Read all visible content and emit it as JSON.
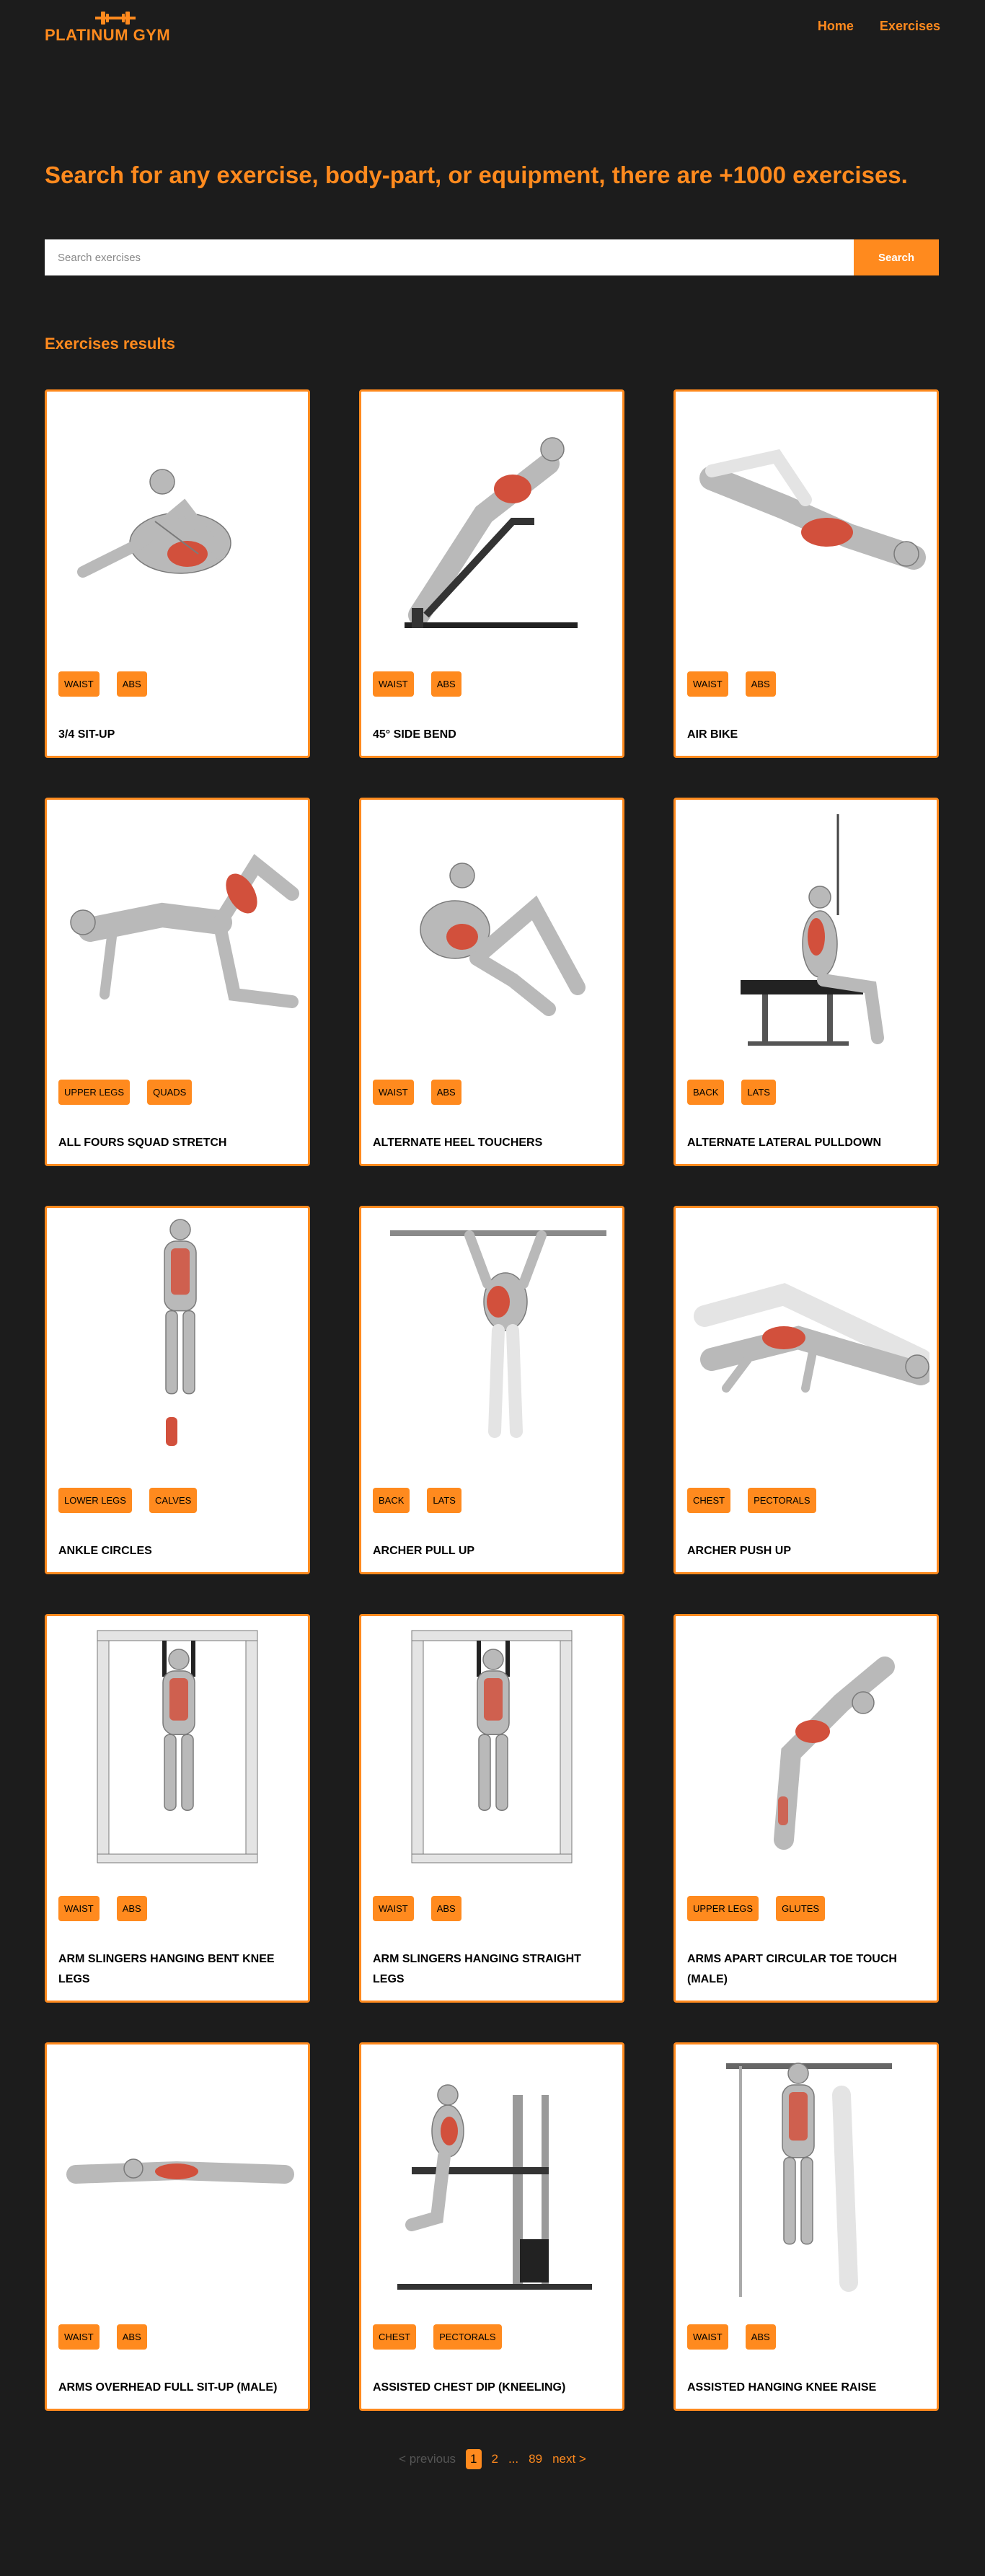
{
  "header": {
    "logo_text": "PLATINUM GYM",
    "nav": [
      {
        "label": "Home"
      },
      {
        "label": "Exercises"
      }
    ]
  },
  "hero": {
    "title": "Search for any exercise, body-part, or equipment, there are +1000 exercises."
  },
  "search": {
    "placeholder": "Search exercises",
    "value": "",
    "button_label": "Search"
  },
  "results": {
    "title": "Exercises results",
    "cards": [
      {
        "name": "3/4 sit-up",
        "tags": [
          "waist",
          "abs"
        ],
        "figure": "situp"
      },
      {
        "name": "45° side bend",
        "tags": [
          "waist",
          "abs"
        ],
        "figure": "sidebend"
      },
      {
        "name": "air bike",
        "tags": [
          "waist",
          "abs"
        ],
        "figure": "airbike"
      },
      {
        "name": "all fours squad stretch",
        "tags": [
          "upper legs",
          "quads"
        ],
        "figure": "allfours"
      },
      {
        "name": "alternate heel touchers",
        "tags": [
          "waist",
          "abs"
        ],
        "figure": "heeltouch"
      },
      {
        "name": "alternate lateral pulldown",
        "tags": [
          "back",
          "lats"
        ],
        "figure": "pulldown"
      },
      {
        "name": "ankle circles",
        "tags": [
          "lower legs",
          "calves"
        ],
        "figure": "standing"
      },
      {
        "name": "archer pull up",
        "tags": [
          "back",
          "lats"
        ],
        "figure": "pullup"
      },
      {
        "name": "archer push up",
        "tags": [
          "chest",
          "pectorals"
        ],
        "figure": "pushup"
      },
      {
        "name": "arm slingers hanging bent knee legs",
        "tags": [
          "waist",
          "abs"
        ],
        "figure": "hangingframe"
      },
      {
        "name": "arm slingers hanging straight legs",
        "tags": [
          "waist",
          "abs"
        ],
        "figure": "hangingframe"
      },
      {
        "name": "arms apart circular toe touch (male)",
        "tags": [
          "upper legs",
          "glutes"
        ],
        "figure": "toetouch"
      },
      {
        "name": "arms overhead full sit-up (male)",
        "tags": [
          "waist",
          "abs"
        ],
        "figure": "lying"
      },
      {
        "name": "assisted chest dip (kneeling)",
        "tags": [
          "chest",
          "pectorals"
        ],
        "figure": "dip"
      },
      {
        "name": "assisted hanging knee raise",
        "tags": [
          "waist",
          "abs"
        ],
        "figure": "kneeraise"
      }
    ]
  },
  "pagination": {
    "previous": "< previous",
    "current": "1",
    "pages": [
      "2"
    ],
    "ellipsis": "...",
    "last": "89",
    "next": "next >"
  },
  "colors": {
    "accent": "#ff8a1e",
    "background": "#1c1c1c",
    "card": "#ffffff"
  }
}
